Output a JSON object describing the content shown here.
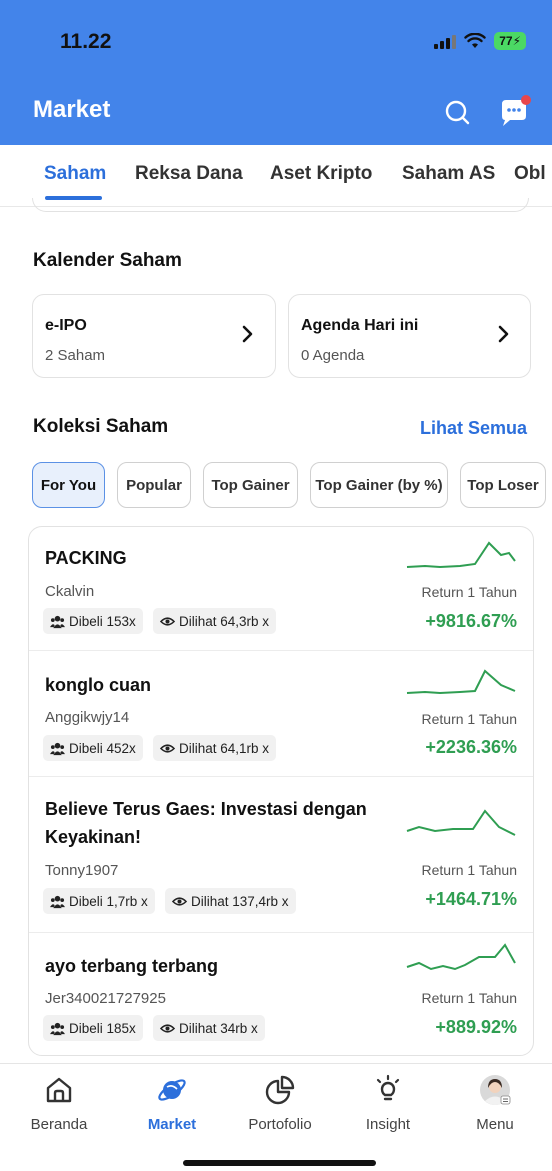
{
  "status_bar": {
    "time": "11.22",
    "battery": "77"
  },
  "header": {
    "title": "Market",
    "search_icon": "search-icon",
    "chat_icon": "chat-notification-icon"
  },
  "tabs": [
    {
      "label": "Saham",
      "active": true
    },
    {
      "label": "Reksa Dana"
    },
    {
      "label": "Aset Kripto"
    },
    {
      "label": "Saham AS"
    },
    {
      "label": "Obl"
    }
  ],
  "kalender": {
    "title": "Kalender Saham",
    "cards": [
      {
        "name": "e-IPO",
        "sub": "2 Saham"
      },
      {
        "name": "Agenda Hari ini",
        "sub": "0 Agenda"
      }
    ]
  },
  "koleksi": {
    "title": "Koleksi Saham",
    "see_all": "Lihat Semua",
    "filters": [
      {
        "label": "For You",
        "active": true
      },
      {
        "label": "Popular"
      },
      {
        "label": "Top Gainer"
      },
      {
        "label": "Top Gainer (by %)"
      },
      {
        "label": "Top Loser"
      }
    ],
    "items": [
      {
        "title": "PACKING",
        "author": "Ckalvin",
        "bought": "Dibeli 153x",
        "viewed": "Dilihat 64,3rb x",
        "return_label": "Return 1 Tahun",
        "return_value": "+9816.67%"
      },
      {
        "title": "konglo cuan",
        "author": "Anggikwjy14",
        "bought": "Dibeli 452x",
        "viewed": "Dilihat 64,1rb x",
        "return_label": "Return 1 Tahun",
        "return_value": "+2236.36%"
      },
      {
        "title_line1": "Believe Terus Gaes: Investasi dengan",
        "title_line2": "Keyakinan!",
        "author": "Tonny1907",
        "bought": "Dibeli 1,7rb x",
        "viewed": "Dilihat 137,4rb x",
        "return_label": "Return 1 Tahun",
        "return_value": "+1464.71%"
      },
      {
        "title": "ayo terbang terbang",
        "author": "Jer340021727925",
        "bought": "Dibeli 185x",
        "viewed": "Dilihat 34rb x",
        "return_label": "Return 1 Tahun",
        "return_value": "+889.92%"
      }
    ]
  },
  "bottom_nav": [
    {
      "label": "Beranda",
      "icon": "home-icon"
    },
    {
      "label": "Market",
      "icon": "planet-icon",
      "active": true
    },
    {
      "label": "Portofolio",
      "icon": "pie-chart-icon"
    },
    {
      "label": "Insight",
      "icon": "lightbulb-icon"
    },
    {
      "label": "Menu",
      "icon": "avatar-icon"
    }
  ],
  "colors": {
    "brand": "#4384ea",
    "accent": "#2c6fdb",
    "positive": "#2f9e52"
  }
}
